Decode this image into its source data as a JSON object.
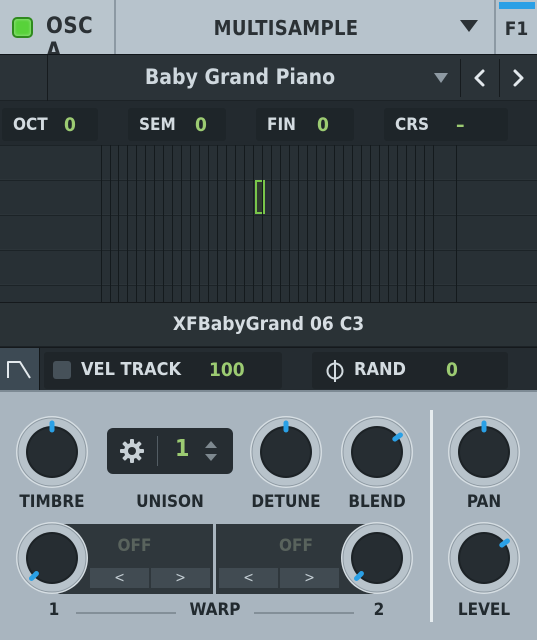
{
  "header": {
    "osc_label": "OSC A",
    "osc_enabled": true,
    "osc_type": "MULTISAMPLE",
    "filter_label": "F1",
    "led_color": "#58d23a",
    "accent_color": "#2aa0e6"
  },
  "preset": {
    "name": "Baby Grand Piano",
    "prev_label": "‹",
    "next_label": "›"
  },
  "pitch": {
    "oct": {
      "label": "OCT",
      "value": "0"
    },
    "sem": {
      "label": "SEM",
      "value": "0"
    },
    "fin": {
      "label": "FIN",
      "value": "0"
    },
    "crs": {
      "label": "CRS",
      "value": "–"
    }
  },
  "keymap": {
    "sample_name": "XFBabyGrand 06 C3"
  },
  "velocity": {
    "label": "VEL TRACK",
    "enabled": false,
    "value": "100"
  },
  "rand": {
    "label": "RAND",
    "value": "0"
  },
  "knobs": {
    "timbre": {
      "label": "TIMBRE",
      "level": 0.5
    },
    "detune": {
      "label": "DETUNE",
      "level": 0.5
    },
    "blend": {
      "label": "BLEND",
      "level": 0.7
    },
    "pan": {
      "label": "PAN",
      "level": 0.5
    },
    "level": {
      "label": "LEVEL",
      "level": 0.7
    },
    "warp1": {
      "label": "1",
      "level": 0.0
    },
    "warp2": {
      "label": "2",
      "level": 0.0
    }
  },
  "unison": {
    "label": "UNISON",
    "value": "1"
  },
  "warp": {
    "label": "WARP",
    "slot1": {
      "mode": "OFF",
      "prev": "<",
      "next": ">"
    },
    "slot2": {
      "mode": "OFF",
      "prev": "<",
      "next": ">"
    }
  },
  "colors": {
    "value_green": "#9ccb72",
    "knob_indicator": "#2aa0e6"
  }
}
